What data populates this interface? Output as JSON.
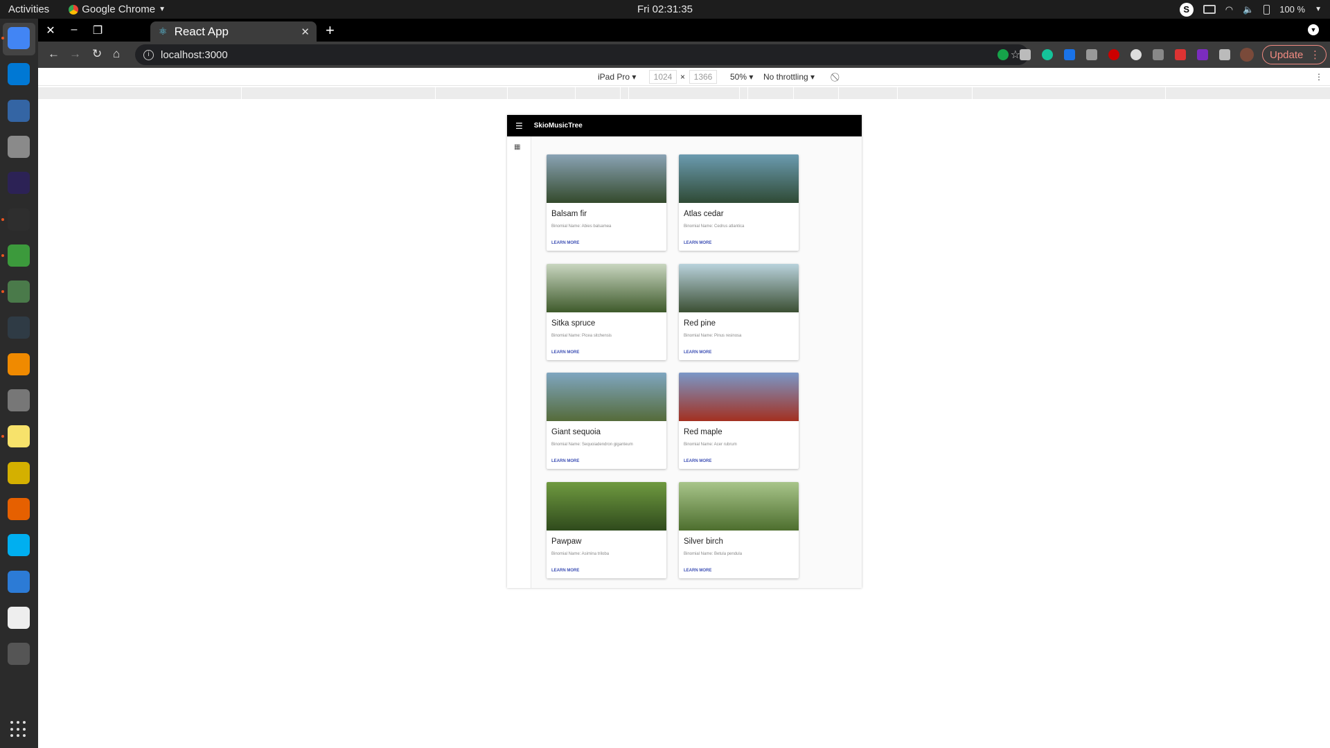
{
  "topbar": {
    "activities": "Activities",
    "app_name": "Google Chrome",
    "clock": "Fri 02:31:35",
    "battery": "100 %"
  },
  "dock": {
    "items": [
      {
        "name": "chrome",
        "color": "#4285f4"
      },
      {
        "name": "vscode",
        "color": "#0078d4"
      },
      {
        "name": "network-manager",
        "color": "#3465a4"
      },
      {
        "name": "file-cabinet",
        "color": "#8a8a8a"
      },
      {
        "name": "eclipse",
        "color": "#2c2255"
      },
      {
        "name": "terminal",
        "color": "#2e2e2e"
      },
      {
        "name": "robo3t",
        "color": "#3c9a3c"
      },
      {
        "name": "node-app",
        "color": "#4a7a4a"
      },
      {
        "name": "system-monitor",
        "color": "#2f3b45"
      },
      {
        "name": "vlc",
        "color": "#f08a00"
      },
      {
        "name": "settings",
        "color": "#777777"
      },
      {
        "name": "notes",
        "color": "#f7e26b"
      },
      {
        "name": "ruler",
        "color": "#d4b000"
      },
      {
        "name": "firefox",
        "color": "#e66000"
      },
      {
        "name": "skype",
        "color": "#00aff0"
      },
      {
        "name": "charts",
        "color": "#2c7bd6"
      },
      {
        "name": "code-editor",
        "color": "#eeeeee"
      },
      {
        "name": "software-updater",
        "color": "#555555"
      }
    ]
  },
  "browser": {
    "tab_title": "React App",
    "url": "localhost:3000",
    "update_label": "Update"
  },
  "devtools": {
    "device": "iPad Pro",
    "width": "1024",
    "height": "1366",
    "zoom": "50%",
    "throttling": "No throttling"
  },
  "app": {
    "brand": "SkioMusicTree",
    "cards": [
      {
        "name": "Balsam fir",
        "binomial": "Binomial Name: Abies balsamea",
        "action": "LEARN MORE",
        "colors": [
          "#8aa3b5",
          "#344a2c"
        ]
      },
      {
        "name": "Atlas cedar",
        "binomial": "Binomial Name: Cedrus atlantica",
        "action": "LEARN MORE",
        "colors": [
          "#6b9bb0",
          "#2f4a35"
        ]
      },
      {
        "name": "Sitka spruce",
        "binomial": "Binomial Name: Picea sitchensis",
        "action": "LEARN MORE",
        "colors": [
          "#c9d6c0",
          "#3e5a2b"
        ]
      },
      {
        "name": "Red pine",
        "binomial": "Binomial Name: Pinus resinosa",
        "action": "LEARN MORE",
        "colors": [
          "#b9d2dc",
          "#3b4f33"
        ]
      },
      {
        "name": "Giant sequoia",
        "binomial": "Binomial Name: Sequoiadendron giganteum",
        "action": "LEARN MORE",
        "colors": [
          "#7fa6c0",
          "#556b3a"
        ]
      },
      {
        "name": "Red maple",
        "binomial": "Binomial Name: Acer rubrum",
        "action": "LEARN MORE",
        "colors": [
          "#7a97c7",
          "#a33020"
        ]
      },
      {
        "name": "Pawpaw",
        "binomial": "Binomial Name: Asimina triloba",
        "action": "LEARN MORE",
        "colors": [
          "#6f9a40",
          "#2f4a1c"
        ]
      },
      {
        "name": "Silver birch",
        "binomial": "Binomial Name: Betula pendula",
        "action": "LEARN MORE",
        "colors": [
          "#a8c58a",
          "#4d6e2e"
        ]
      }
    ]
  }
}
